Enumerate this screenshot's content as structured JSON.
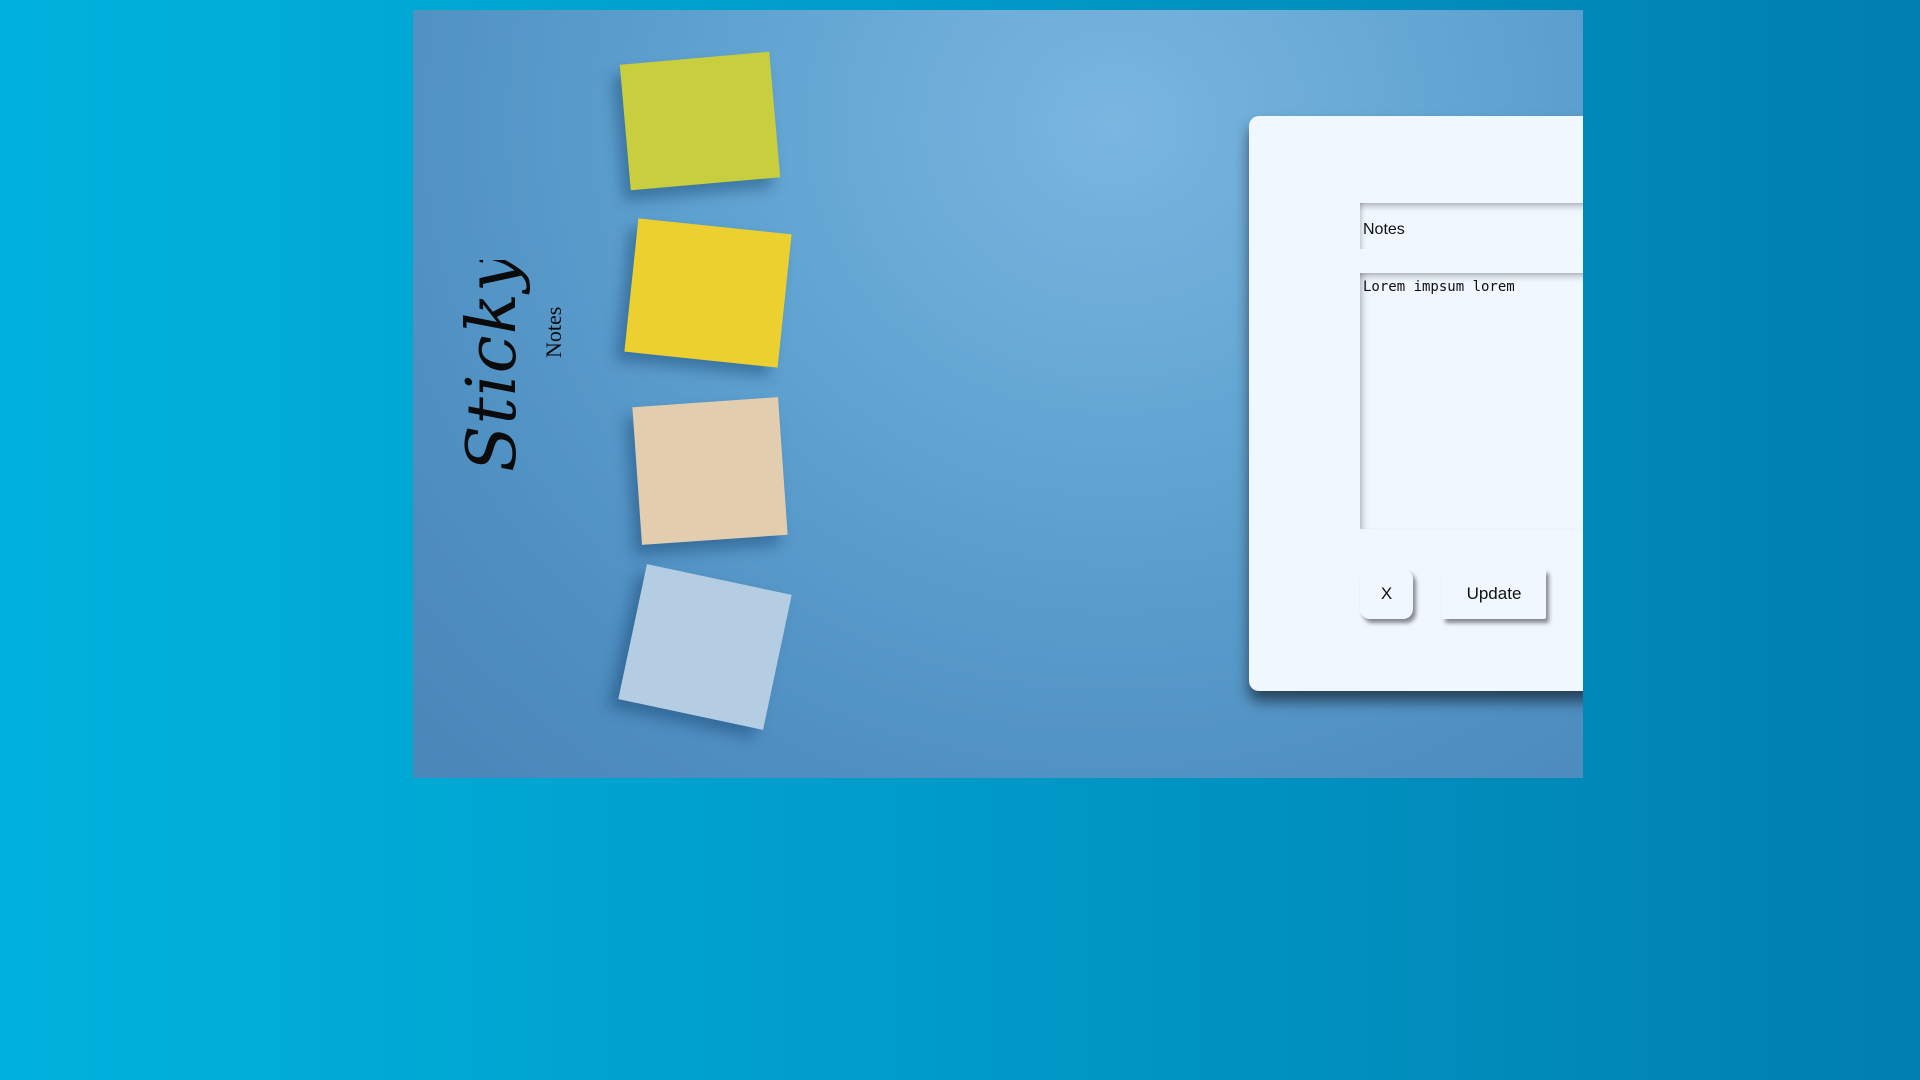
{
  "logo": {
    "word1": "Sticky",
    "word2": "Notes"
  },
  "form": {
    "title_value": "Notes",
    "body_value": "Lorem impsum lorem",
    "close_label": "X",
    "update_label": "Update"
  },
  "colors": {
    "page_background": "#009ac8",
    "hero_background": "#5fa3d1",
    "card_background": "#f0f7ff",
    "note_lime": "#c8ce3e",
    "note_yellow": "#ecd02f",
    "note_beige": "#e2cdaf",
    "note_blue": "#b5cde3"
  }
}
